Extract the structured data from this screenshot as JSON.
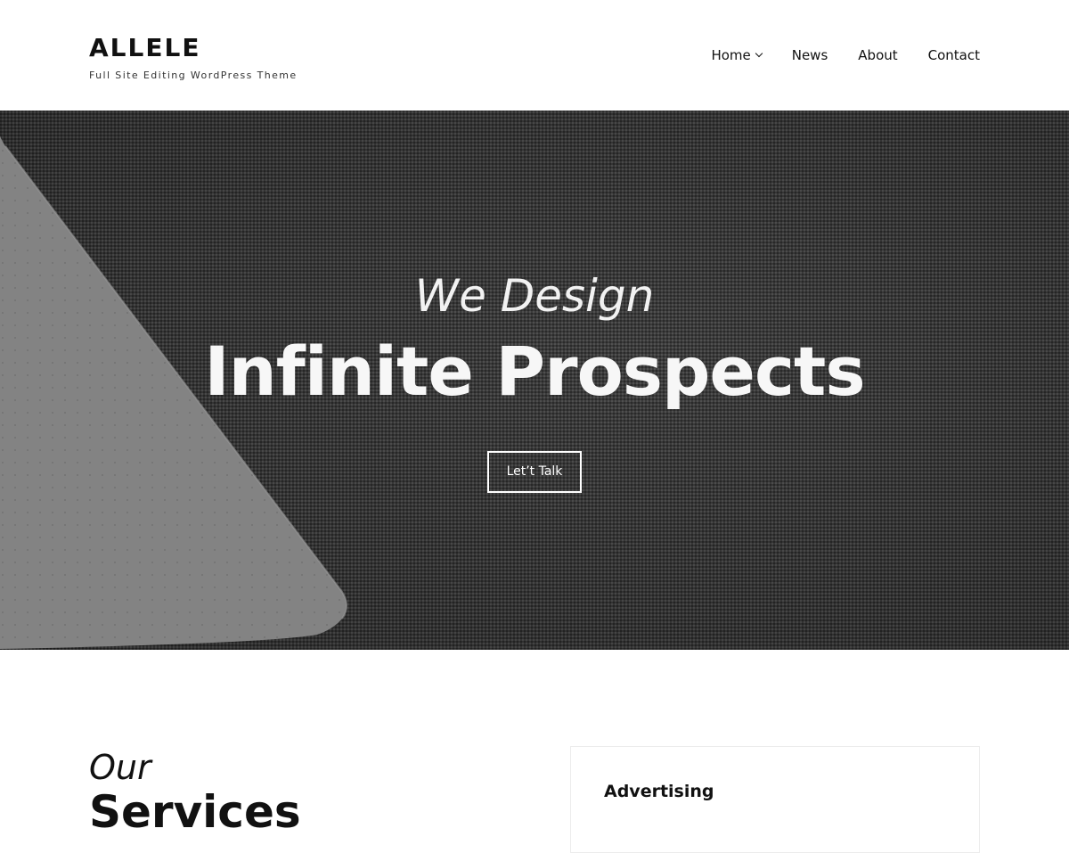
{
  "header": {
    "site_title": "ALLELE",
    "tagline": "Full Site Editing WordPress Theme",
    "nav": [
      {
        "label": "Home",
        "has_submenu": true
      },
      {
        "label": "News"
      },
      {
        "label": "About"
      },
      {
        "label": "Contact"
      }
    ]
  },
  "hero": {
    "eyebrow": "We Design",
    "title": "Infinite Prospects",
    "button_label": "Let’t Talk"
  },
  "services": {
    "heading_italic": "Our",
    "heading_bold": "Services",
    "cards": [
      {
        "title": "Advertising"
      }
    ]
  },
  "icons": {
    "submenu_indicator": "chevron-down-icon"
  }
}
